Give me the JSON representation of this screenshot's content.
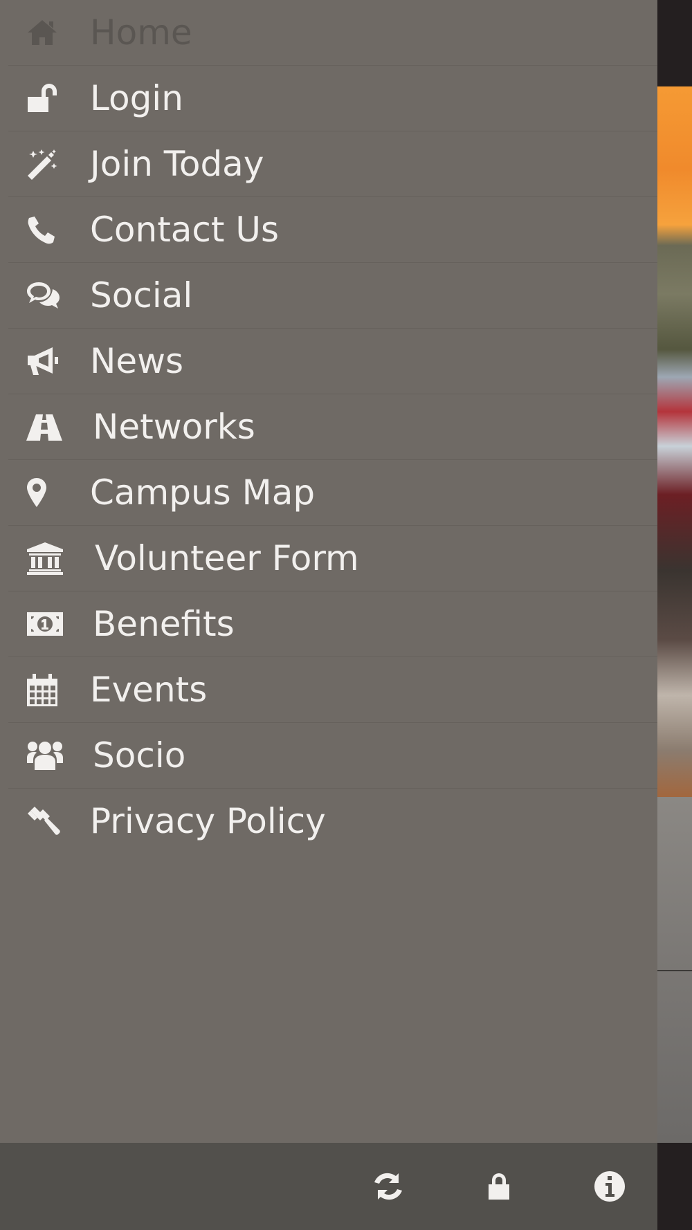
{
  "drawer": {
    "items": [
      {
        "label": "Home",
        "icon": "home-icon",
        "active": true
      },
      {
        "label": "Login",
        "icon": "unlock-icon"
      },
      {
        "label": "Join Today",
        "icon": "magic-wand-icon"
      },
      {
        "label": "Contact Us",
        "icon": "phone-icon"
      },
      {
        "label": "Social",
        "icon": "chat-bubbles-icon"
      },
      {
        "label": "News",
        "icon": "megaphone-icon"
      },
      {
        "label": "Networks",
        "icon": "road-icon"
      },
      {
        "label": "Campus Map",
        "icon": "map-marker-icon"
      },
      {
        "label": "Volunteer Form",
        "icon": "institution-icon"
      },
      {
        "label": "Benefits",
        "icon": "money-icon"
      },
      {
        "label": "Events",
        "icon": "calendar-icon"
      },
      {
        "label": "Socio",
        "icon": "users-icon"
      },
      {
        "label": "Privacy Policy",
        "icon": "gavel-icon"
      }
    ]
  },
  "toolbar": {
    "buttons": [
      {
        "icon": "refresh-icon"
      },
      {
        "icon": "lock-icon"
      },
      {
        "icon": "info-icon"
      }
    ]
  },
  "colors": {
    "drawer_bg": "#6f6a65",
    "toolbar_bg": "#52504c",
    "text": "#f2f0ee",
    "active_text": "#5a5652"
  }
}
